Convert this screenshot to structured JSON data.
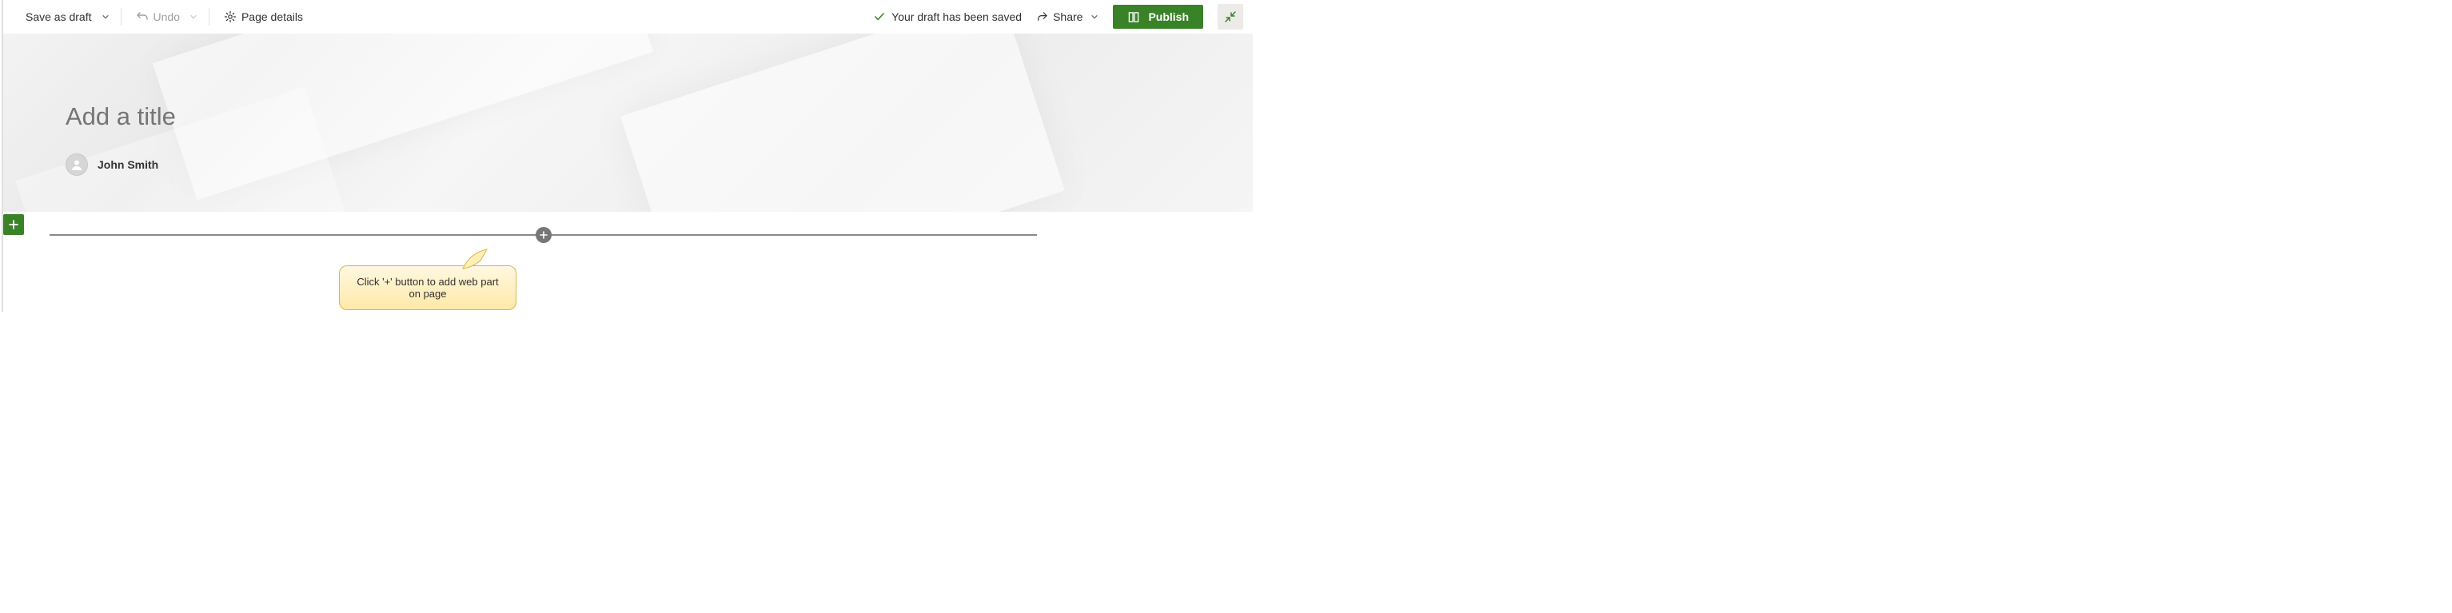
{
  "toolbar": {
    "save_as_draft": "Save as draft",
    "undo": "Undo",
    "page_details": "Page details",
    "draft_saved": "Your draft has been saved",
    "share": "Share",
    "publish": "Publish"
  },
  "hero": {
    "title_placeholder": "Add a title",
    "author_name": "John Smith"
  },
  "callout": {
    "text": "Click '+' button to add web part on page"
  },
  "colors": {
    "primary": "#3a8228"
  }
}
